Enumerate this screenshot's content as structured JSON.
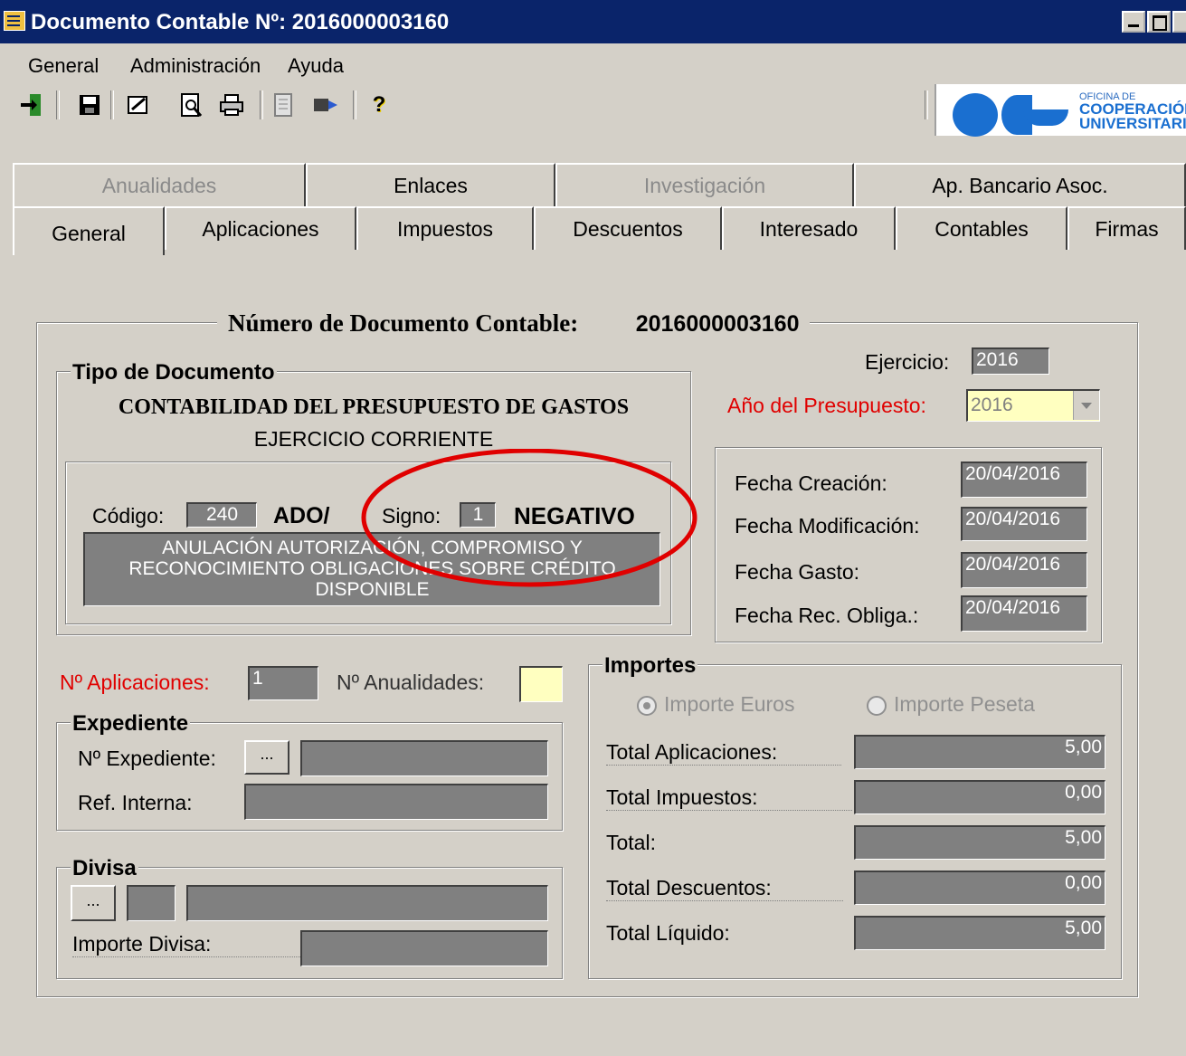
{
  "window": {
    "title": "Documento Contable Nº: 2016000003160"
  },
  "menu": [
    "General",
    "Administración",
    "Ayuda"
  ],
  "toolbar": {
    "icons": [
      "exit-icon",
      "save-icon",
      "edit-icon",
      "preview-icon",
      "print-icon",
      "document-icon",
      "refresh-icon",
      "help-icon"
    ],
    "help_glyph": "?"
  },
  "logo": {
    "line1": "OFICINA DE",
    "line2": "COOPERACIÓN",
    "line3": "UNIVERSITARIA"
  },
  "tabs_row1": [
    {
      "label": "Anualidades",
      "enabled": false
    },
    {
      "label": "Enlaces",
      "enabled": true
    },
    {
      "label": "Investigación",
      "enabled": false
    },
    {
      "label": "Ap. Bancario Asoc.",
      "enabled": true
    }
  ],
  "tabs_row2": [
    {
      "label": "General",
      "active": true
    },
    {
      "label": "Aplicaciones"
    },
    {
      "label": "Impuestos"
    },
    {
      "label": "Descuentos"
    },
    {
      "label": "Interesado"
    },
    {
      "label": "Contables"
    },
    {
      "label": "Firmas"
    }
  ],
  "doc": {
    "heading_label": "Número de Documento Contable:",
    "number": "2016000003160"
  },
  "tipo": {
    "legend": "Tipo de Documento",
    "line1": "CONTABILIDAD DEL PRESUPUESTO DE GASTOS",
    "line2": "EJERCICIO CORRIENTE",
    "codigo_label": "Código:",
    "codigo_value": "240",
    "codigo_name": "ADO/",
    "signo_label": "Signo:",
    "signo_value": "1",
    "signo_name": "NEGATIVO",
    "description": "ANULACIÓN AUTORIZACIÓN, COMPROMISO Y RECONOCIMIENTO OBLIGACIONES SOBRE CRÉDITO DISPONIBLE"
  },
  "ejercicio": {
    "label": "Ejercicio:",
    "value": "2016",
    "anio_label": "Año del Presupuesto:",
    "anio_value": "2016"
  },
  "fechas": {
    "creacion_label": "Fecha Creación:",
    "creacion": "20/04/2016",
    "modificacion_label": "Fecha Modificación:",
    "modificacion": "20/04/2016",
    "gasto_label": "Fecha Gasto:",
    "gasto": "20/04/2016",
    "rec_label": "Fecha Rec. Obliga.:",
    "rec": "20/04/2016"
  },
  "aplicaciones": {
    "label": "Nº Aplicaciones:",
    "value": "1",
    "anualidades_label": "Nº Anualidades:",
    "anualidades_value": ""
  },
  "expediente": {
    "legend": "Expediente",
    "num_label": "Nº Expediente:",
    "num_button": "...",
    "num_value": "",
    "ref_label": "Ref. Interna:",
    "ref_value": ""
  },
  "divisa": {
    "legend": "Divisa",
    "button": "...",
    "code": "",
    "name": "",
    "importe_label": "Importe Divisa:",
    "importe_value": ""
  },
  "importes": {
    "legend": "Importes",
    "radio_euros": "Importe Euros",
    "radio_peseta": "Importe Peseta",
    "selected": "euros",
    "rows": [
      {
        "label": "Total Aplicaciones:",
        "value": "5,00"
      },
      {
        "label": "Total Impuestos:",
        "value": "0,00"
      },
      {
        "label": "Total:",
        "value": "5,00"
      },
      {
        "label": "Total Descuentos:",
        "value": "0,00"
      },
      {
        "label": "Total Líquido:",
        "value": "5,00"
      }
    ]
  },
  "annotation_color": "#e00000"
}
